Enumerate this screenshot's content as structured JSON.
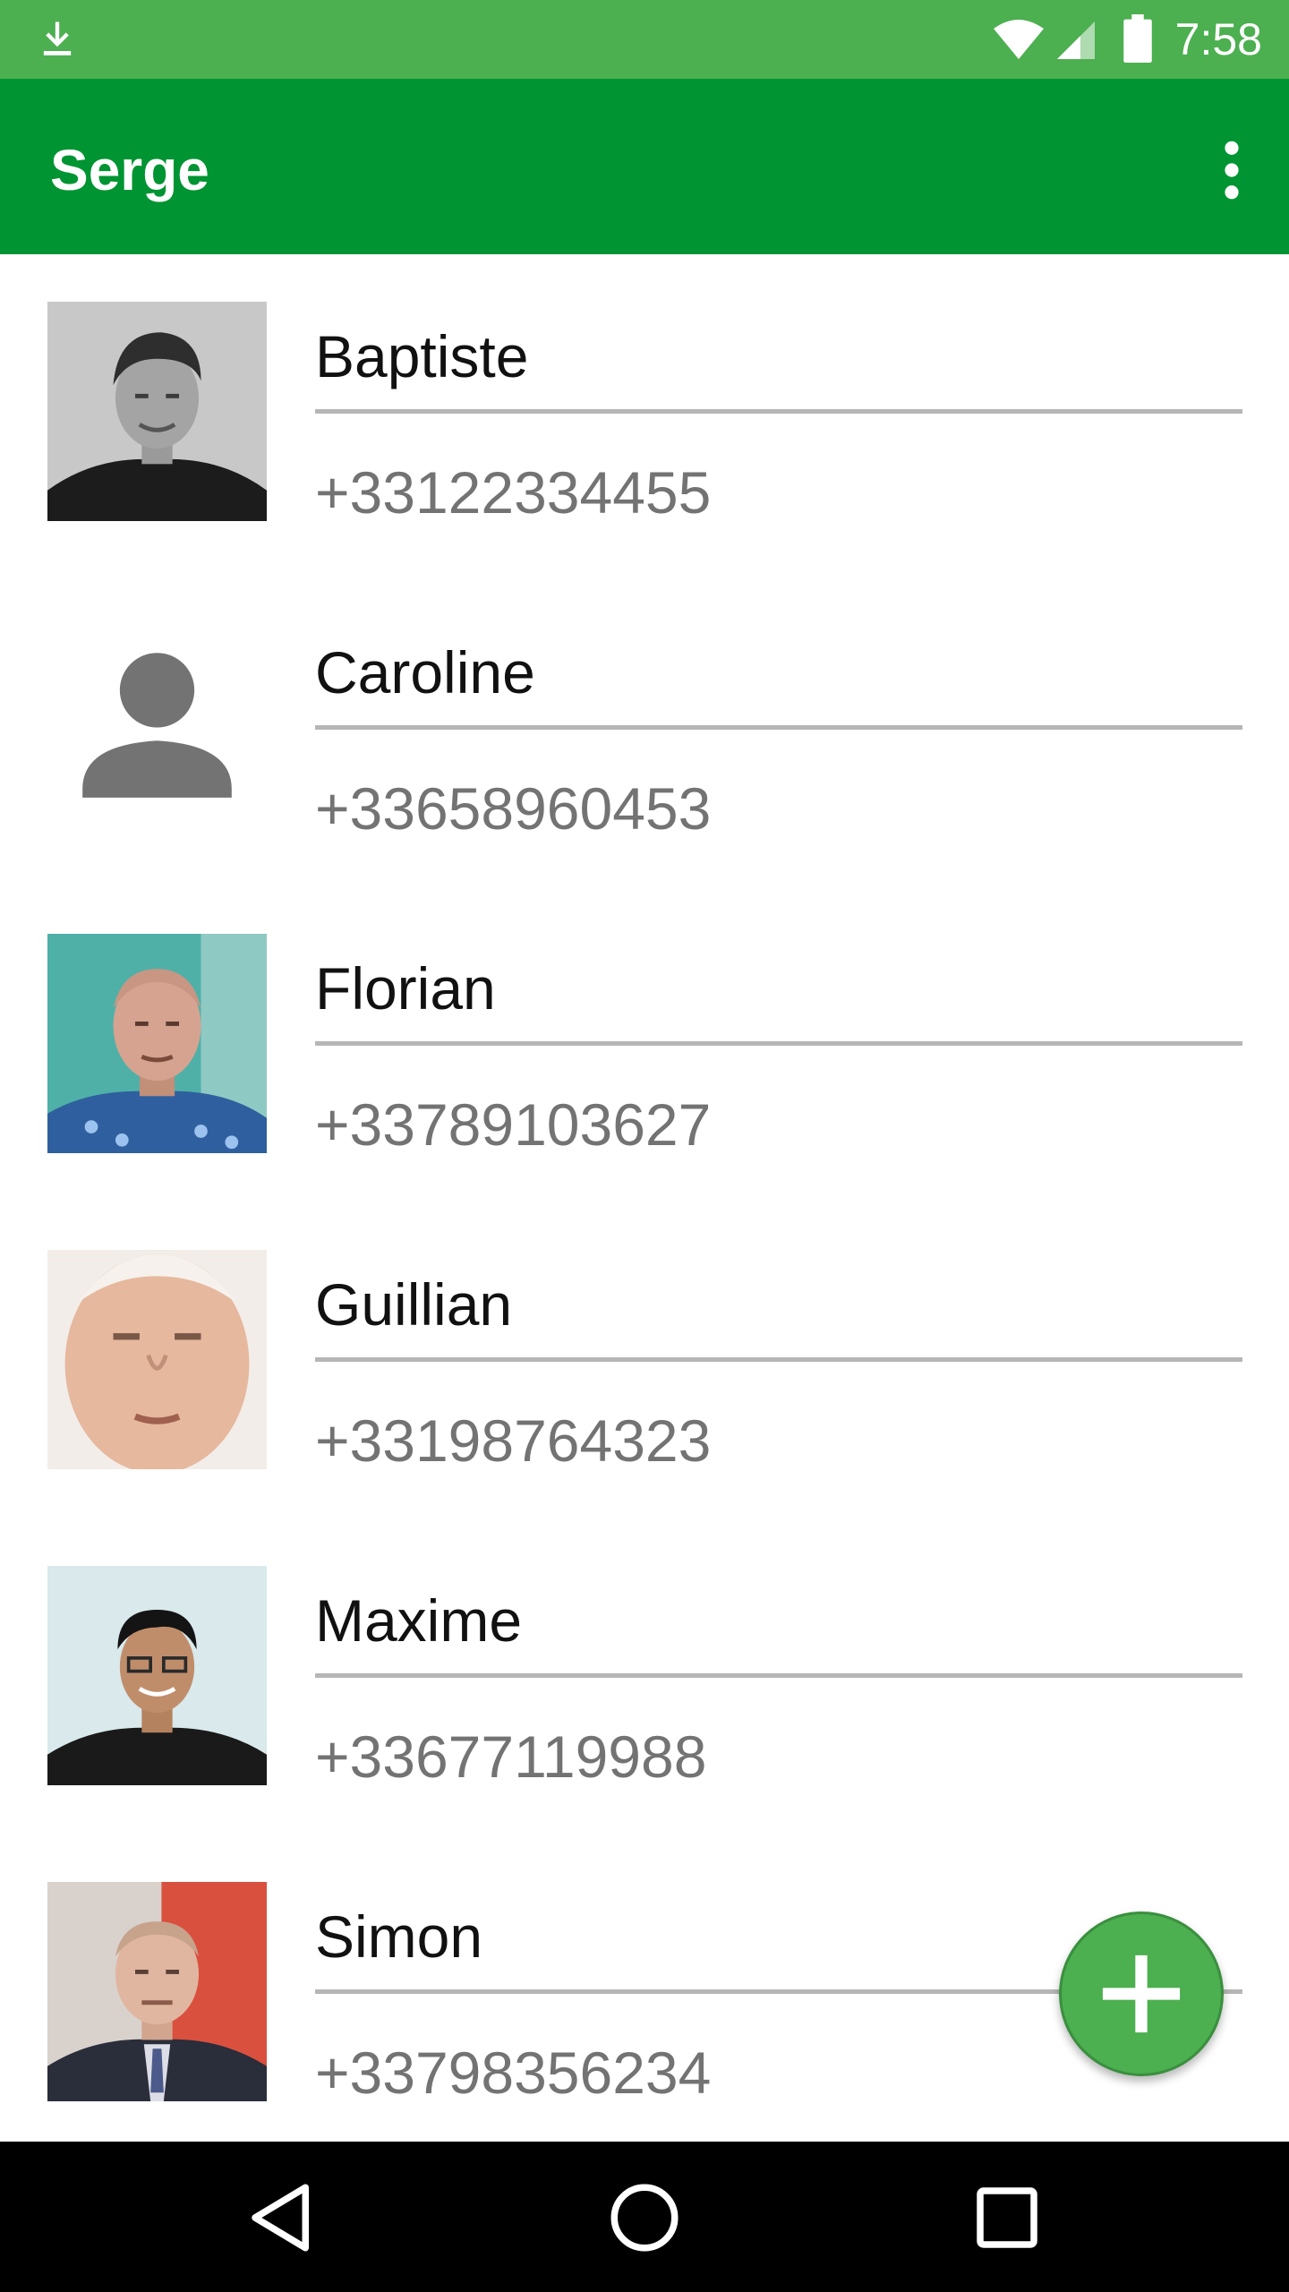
{
  "status_bar": {
    "time": "7:58",
    "icons": [
      "download-icon",
      "wifi-icon",
      "signal-icon",
      "battery-icon"
    ]
  },
  "toolbar": {
    "title": "Serge",
    "overflow_icon": "more-vert-icon"
  },
  "contacts": [
    {
      "name": "Baptiste",
      "phone": "+33122334455",
      "avatar": "photo"
    },
    {
      "name": "Caroline",
      "phone": "+33658960453",
      "avatar": "placeholder-person-icon"
    },
    {
      "name": "Florian",
      "phone": "+33789103627",
      "avatar": "photo"
    },
    {
      "name": "Guillian",
      "phone": "+33198764323",
      "avatar": "photo"
    },
    {
      "name": "Maxime",
      "phone": "+33677119988",
      "avatar": "photo"
    },
    {
      "name": "Simon",
      "phone": "+33798356234",
      "avatar": "photo"
    }
  ],
  "fab": {
    "icon": "plus-icon"
  },
  "nav_bar": {
    "icons": [
      "back-icon",
      "home-icon",
      "recents-icon"
    ]
  },
  "colors": {
    "status_bar": "#4caf50",
    "toolbar": "#009432",
    "fab": "#4caf50",
    "divider": "#b6b6b6",
    "phone_text": "#737373"
  }
}
